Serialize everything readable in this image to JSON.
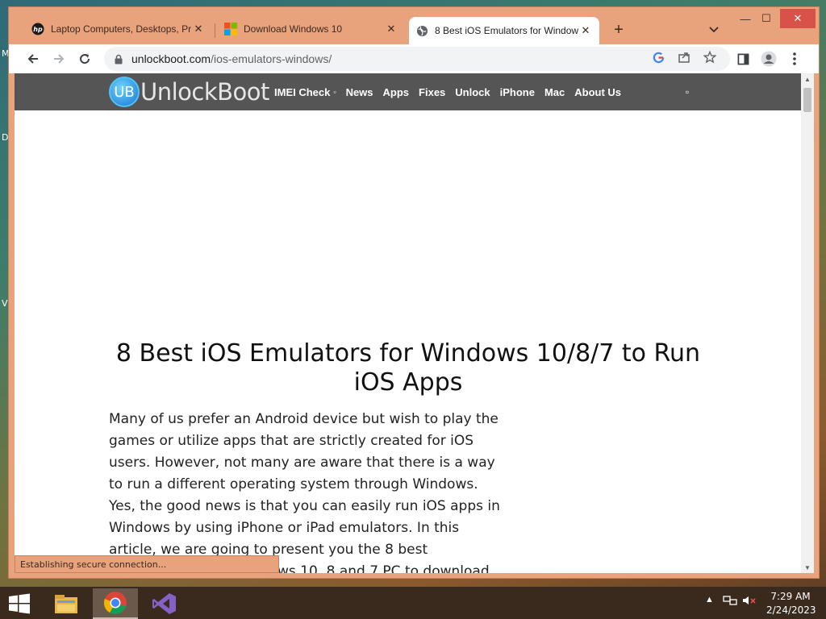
{
  "desktop": {
    "fragments": [
      "M",
      "D",
      "V"
    ]
  },
  "browser": {
    "tabs": [
      {
        "label": "Laptop Computers, Desktops, Pr",
        "favicon": "hp-icon"
      },
      {
        "label": "Download Windows 10",
        "favicon": "windows-logo-icon"
      },
      {
        "label": "8 Best iOS Emulators for Window",
        "favicon": "globe-icon"
      }
    ],
    "new_tab": "+",
    "window_controls": {
      "minimize": "—",
      "maximize": "☐",
      "close": "✕"
    },
    "url": {
      "domain": "unlockboot.com",
      "path": "/ios-emulators-windows/"
    },
    "status": "Establishing secure connection..."
  },
  "site": {
    "logo_badge": "UB",
    "logo_text": "UnlockBoot",
    "menu": [
      {
        "label": "IMEI Check",
        "has_dropdown": true
      },
      {
        "label": "News"
      },
      {
        "label": "Apps"
      },
      {
        "label": "Fixes"
      },
      {
        "label": "Unlock"
      },
      {
        "label": "iPhone"
      },
      {
        "label": "Mac"
      },
      {
        "label": "About Us"
      }
    ],
    "headline": "8 Best iOS Emulators for Windows 10/8/7 to Run iOS Apps",
    "intro_partial": "Many of us prefer an Android device but wish to play the games or utilize apps that are strictly created for iOS users. However, not many are aware that there is a way to run a different operating system through Windows. Yes, the good news is that you can easily run iOS apps in Windows by using iPhone or iPad emulators. In this article, we are going to present you the 8 best",
    "intro_tail": "ws 10, 8 and 7 PC to download"
  },
  "taskbar": {
    "clock_time": "7:29 AM",
    "clock_date": "2/24/2023"
  },
  "colors": {
    "titlebar": "#e8a27c",
    "sitebar": "#555555",
    "taskbar": "#3a2a1e",
    "close_button": "#d9524a"
  }
}
